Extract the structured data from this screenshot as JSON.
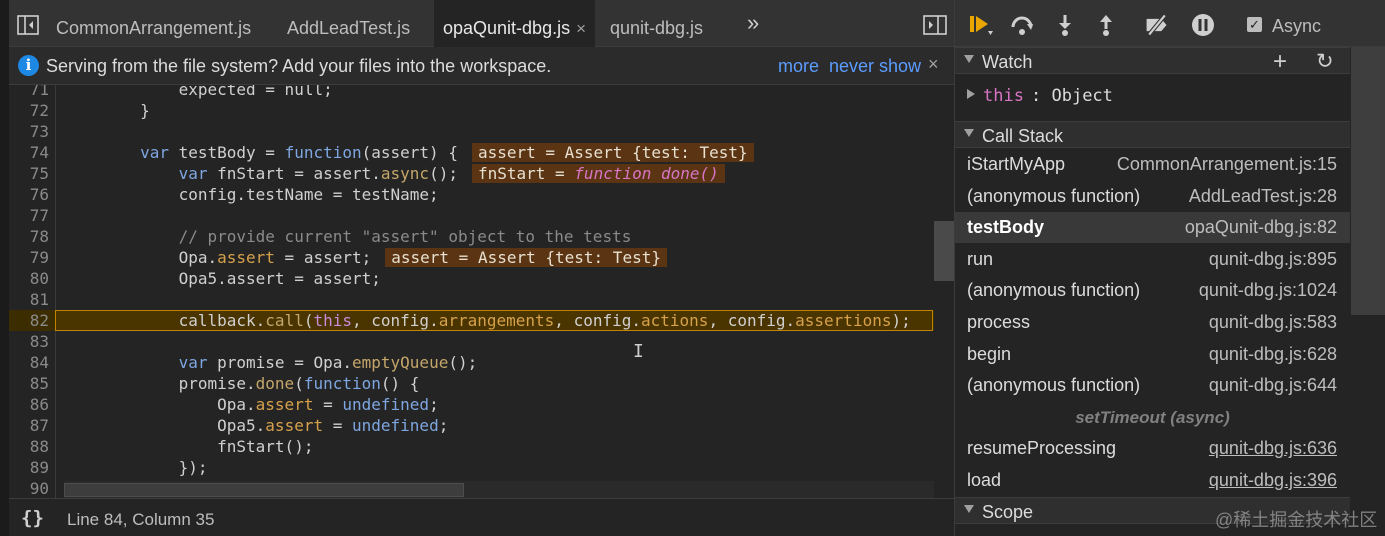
{
  "tabs": [
    {
      "label": "CommonArrangement.js",
      "active": false
    },
    {
      "label": "AddLeadTest.js",
      "active": false
    },
    {
      "label": "opaQunit-dbg.js",
      "active": true
    },
    {
      "label": "qunit-dbg.js",
      "active": false
    }
  ],
  "tab_close_glyph": "×",
  "tab_overflow_glyph": "»",
  "infobar": {
    "message": "Serving from the file system? Add your files into the workspace.",
    "more": "more",
    "never_show": "never show",
    "close": "×",
    "icon": "i"
  },
  "editor": {
    "lines": [
      {
        "n": "71",
        "code": "            expected = null;"
      },
      {
        "n": "72",
        "code": "        }"
      },
      {
        "n": "73",
        "code": ""
      },
      {
        "n": "74",
        "code": ""
      },
      {
        "n": "75",
        "code": ""
      },
      {
        "n": "76",
        "code": "            config.testName = testName;"
      },
      {
        "n": "77",
        "code": ""
      },
      {
        "n": "78",
        "code": ""
      },
      {
        "n": "79",
        "code": ""
      },
      {
        "n": "80",
        "code": "            Opa5.assert = assert;"
      },
      {
        "n": "81",
        "code": ""
      },
      {
        "n": "82",
        "code": ""
      },
      {
        "n": "83",
        "code": ""
      },
      {
        "n": "84",
        "code": ""
      },
      {
        "n": "85",
        "code": ""
      },
      {
        "n": "86",
        "code": ""
      },
      {
        "n": "87",
        "code": ""
      },
      {
        "n": "88",
        "code": "                fnStart();"
      },
      {
        "n": "89",
        "code": "            });"
      },
      {
        "n": "90",
        "code": ""
      }
    ],
    "line74": {
      "indent": "        ",
      "kw": "var",
      "rest": " testBody = ",
      "fn": "function",
      "args": "(assert) {",
      "inline": "assert = Assert {test: Test}"
    },
    "line75": {
      "indent": "            ",
      "kw": "var",
      "rest1": " fnStart = assert.",
      "call": "async",
      "rest2": "();",
      "inline_pre": "fnStart = ",
      "inline_fn": "function",
      "inline_name": " done()"
    },
    "line78": {
      "comment": "            // provide current \"assert\" object to the tests"
    },
    "line79": {
      "pre": "            Opa.",
      "prop": "assert",
      "rest": " = assert;",
      "inline": "assert = Assert {test: Test}"
    },
    "line82": {
      "pre": "            callback.",
      "call": "call",
      "open": "(",
      "this": "this",
      "c1": ", config.",
      "p1": "arrangements",
      "c2": ", config.",
      "p2": "actions",
      "c3": ", config.",
      "p3": "assertions",
      "end": ");"
    },
    "line84": {
      "indent": "            ",
      "kw": "var",
      "rest": " promise = Opa.",
      "call": "emptyQueue",
      "end": "();"
    },
    "line85": {
      "pre": "            promise.",
      "call": "done",
      "open": "(",
      "fn": "function",
      "end": "() {"
    },
    "line86": {
      "pre": "                Opa.",
      "prop": "assert",
      "mid": " = ",
      "undef": "undefined",
      "end": ";"
    },
    "line87": {
      "pre": "                Opa5.",
      "prop": "assert",
      "mid": " = ",
      "undef": "undefined",
      "end": ";"
    },
    "cursor_glyph": "I"
  },
  "status": {
    "pretty_print": "{}",
    "position": "Line 84, Column 35"
  },
  "debugger": {
    "async_label": "Async",
    "async_checked": true,
    "watch": {
      "title": "Watch",
      "add": "+",
      "refresh": "↻",
      "item_name": "this",
      "item_sep": ": ",
      "item_value": "Object"
    },
    "call_stack": {
      "title": "Call Stack",
      "frames": [
        {
          "name": "iStartMyApp",
          "loc": "CommonArrangement.js:15"
        },
        {
          "name": "(anonymous function)",
          "loc": "AddLeadTest.js:28"
        },
        {
          "name": "testBody",
          "loc": "opaQunit-dbg.js:82"
        },
        {
          "name": "run",
          "loc": "qunit-dbg.js:895"
        },
        {
          "name": "(anonymous function)",
          "loc": "qunit-dbg.js:1024"
        },
        {
          "name": "process",
          "loc": "qunit-dbg.js:583"
        },
        {
          "name": "begin",
          "loc": "qunit-dbg.js:628"
        },
        {
          "name": "(anonymous function)",
          "loc": "qunit-dbg.js:644"
        }
      ],
      "async_separator": "setTimeout (async)",
      "async_frames": [
        {
          "name": "resumeProcessing",
          "loc": "qunit-dbg.js:636"
        },
        {
          "name": "load",
          "loc": "qunit-dbg.js:396"
        }
      ]
    },
    "scope": {
      "title": "Scope"
    }
  },
  "watermark": "@稀土掘金技术社区",
  "colors": {
    "accent": "#e9a700",
    "link": "#5b9cff",
    "exec_line": "#4a3500",
    "inline_value_bg": "#5a3413"
  }
}
